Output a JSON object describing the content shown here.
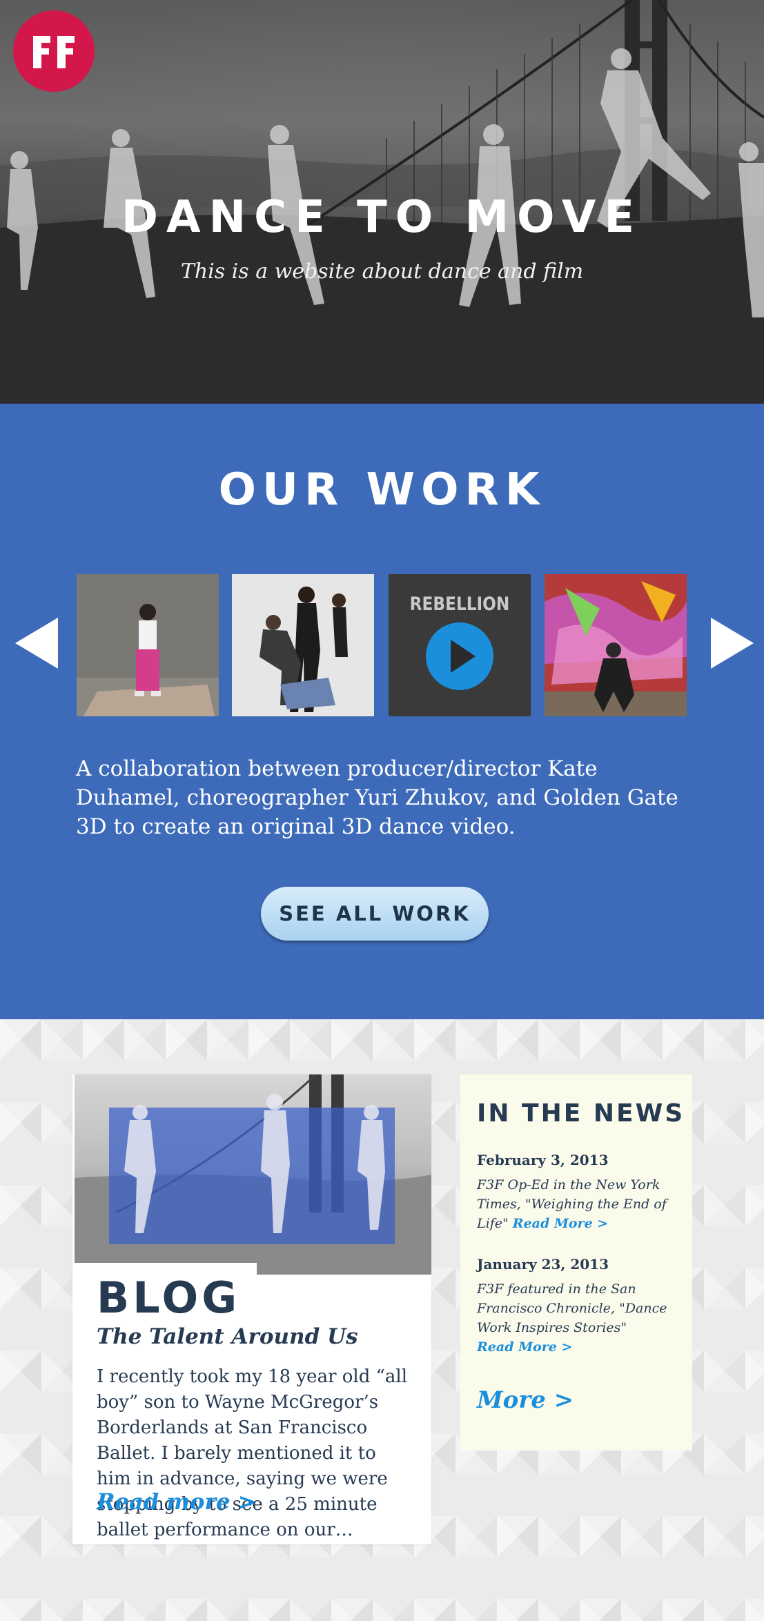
{
  "hero": {
    "logo_text": "FF",
    "title": "DANCE TO MOVE",
    "subtitle": "This is a website about dance and film"
  },
  "work": {
    "title": "OUR WORK",
    "thumbnails": [
      {
        "icon": "dancer-photo"
      },
      {
        "icon": "group-dance-photo"
      },
      {
        "icon": "video-play-icon",
        "label": "REBELLION"
      },
      {
        "icon": "graffiti-dancer-photo"
      }
    ],
    "description": "A collaboration between producer/director Kate Duhamel, choreographer Yuri Zhukov, and Golden Gate 3D to create an original 3D dance video.",
    "button_label": "SEE ALL WORK",
    "colors": {
      "background": "#3e6bb9",
      "button": "#a9d2f0"
    }
  },
  "blog": {
    "title": "BLOG",
    "post_title": "The Talent Around Us",
    "excerpt": "I recently took my 18 year old “all boy” son to Wayne McGregor’s Borderlands at San Francisco Ballet.  I barely mentioned it to him in advance, saying we were stopping by to see a 25 minute ballet performance on our…",
    "read_more": "Read more >"
  },
  "news": {
    "title": "IN THE NEWS",
    "items": [
      {
        "date": "February 3, 2013",
        "text": "F3F Op-Ed in the New York Times, \"Weighing the End of Life\"",
        "link": "Read More >"
      },
      {
        "date": "January 23, 2013",
        "text": "F3F featured in the San Francisco Chronicle, \"Dance Work Inspires Stories\"",
        "link": "Read More >"
      }
    ],
    "more": "More >"
  },
  "colors": {
    "accent": "#1b8fdc",
    "brand": "#d4174a",
    "text_dark": "#263a52"
  }
}
